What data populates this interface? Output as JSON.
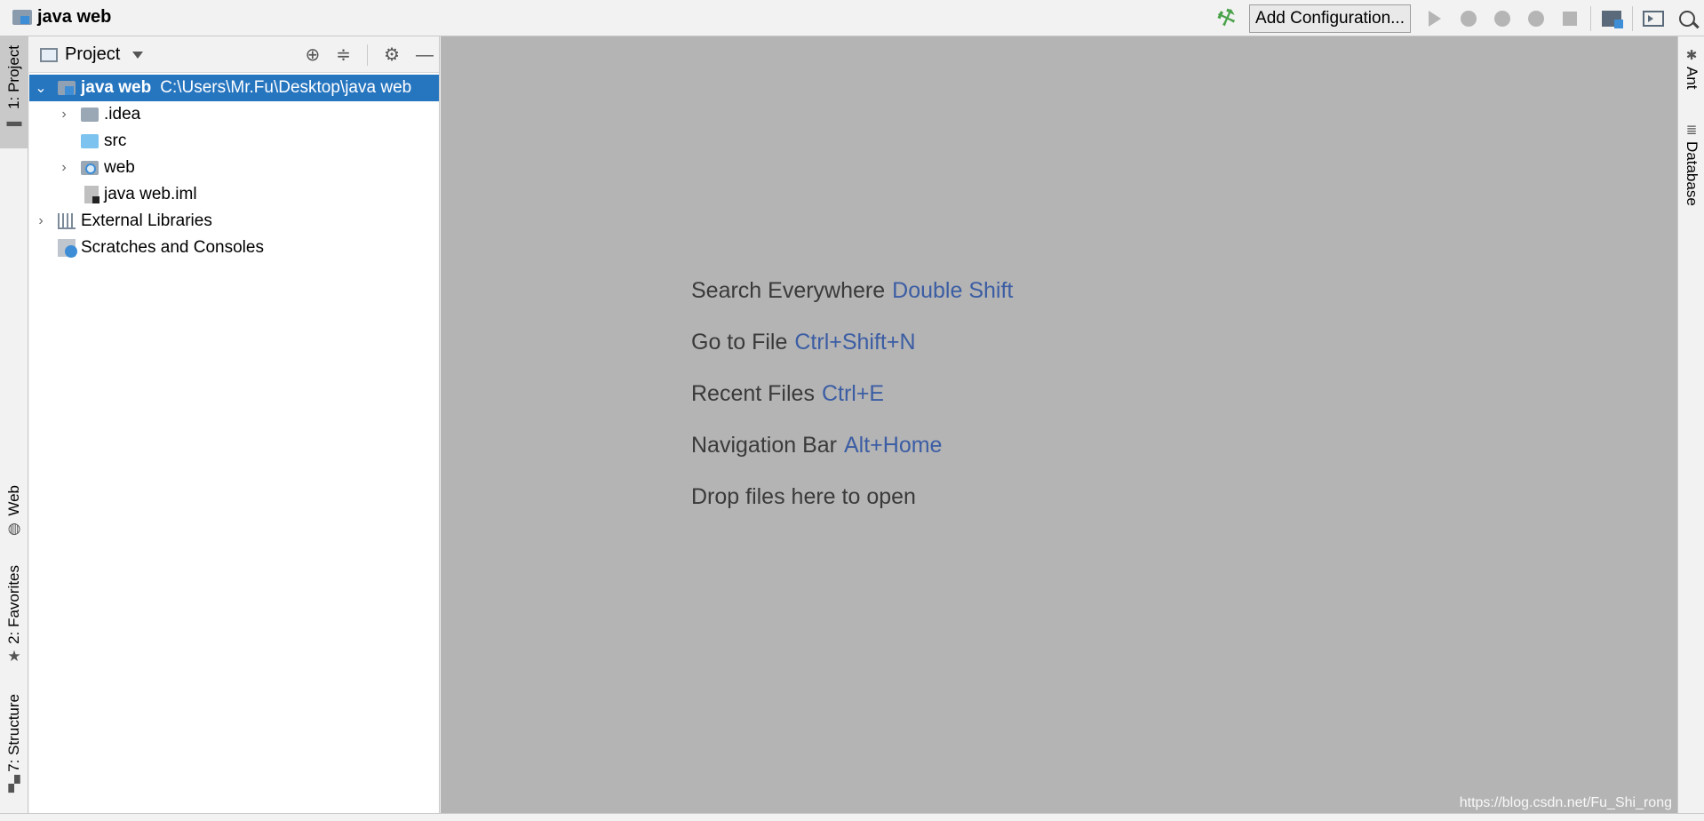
{
  "window": {
    "project_title": "java web"
  },
  "toolbar": {
    "add_configuration_label": "Add Configuration...",
    "icons": [
      "build-hammer-icon",
      "run-icon",
      "debug-icon",
      "coverage-icon",
      "profile-icon",
      "stop-icon",
      "project-structure-icon",
      "terminal-icon",
      "search-icon"
    ]
  },
  "left_tool_strip": {
    "project_tab": "1: Project",
    "web_tab": "Web",
    "favorites_tab": "2: Favorites",
    "structure_tab": "7: Structure"
  },
  "right_tool_strip": {
    "ant_tab": "Ant",
    "database_tab": "Database"
  },
  "project_panel": {
    "title": "Project",
    "tree": {
      "root_name": "java web",
      "root_path": "C:\\Users\\Mr.Fu\\Desktop\\java web",
      "idea": ".idea",
      "src": "src",
      "web": "web",
      "iml": "java web.iml",
      "external_libraries": "External Libraries",
      "scratches": "Scratches and Consoles"
    }
  },
  "editor": {
    "hints": [
      {
        "label": "Search Everywhere",
        "shortcut": "Double Shift"
      },
      {
        "label": "Go to File",
        "shortcut": "Ctrl+Shift+N"
      },
      {
        "label": "Recent Files",
        "shortcut": "Ctrl+E"
      },
      {
        "label": "Navigation Bar",
        "shortcut": "Alt+Home"
      },
      {
        "label": "Drop files here to open",
        "shortcut": ""
      }
    ],
    "watermark": "https://blog.csdn.net/Fu_Shi_rong"
  },
  "colors": {
    "selection": "#2675bf",
    "editor_bg": "#b4b4b4",
    "shortcut": "#3b5da4"
  }
}
